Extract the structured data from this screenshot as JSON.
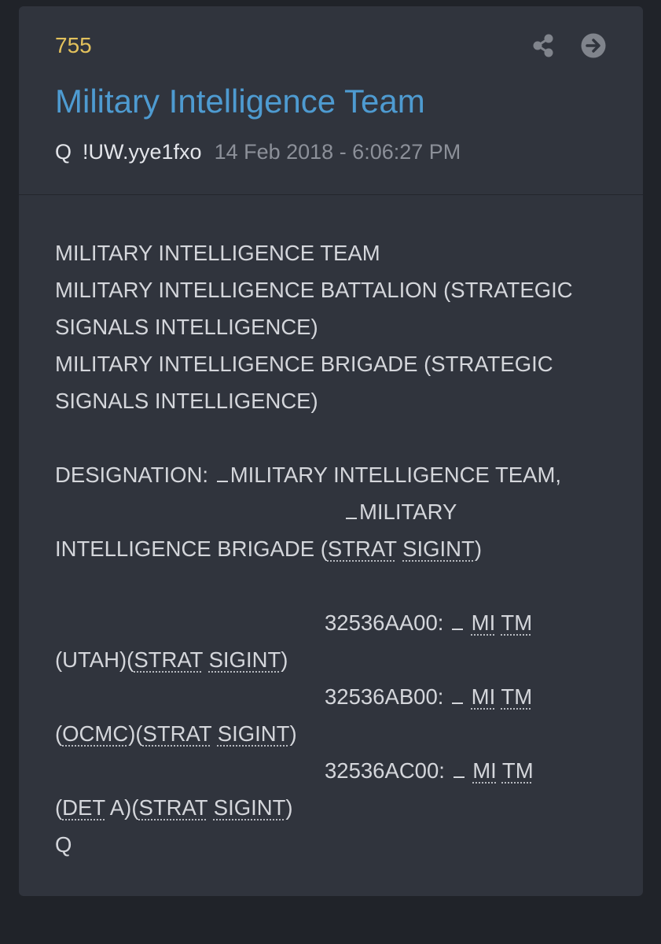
{
  "post": {
    "number": "755",
    "title": "Military Intelligence Team",
    "author": "Q",
    "tripcode": "!UW.yye1fxo",
    "timestamp": "14 Feb 2018 - 6:06:27 PM"
  },
  "icons": {
    "share": "share-icon",
    "go": "arrow-right-circle-icon",
    "color": "#80848c"
  },
  "colors": {
    "number": "#e2c15c",
    "title": "#4e9bd1",
    "text": "#d4d6db",
    "card": "#30343d",
    "background": "#202329"
  },
  "body": {
    "l1": "MILITARY INTELLIGENCE TEAM",
    "l2": "MILITARY INTELLIGENCE BATTALION (STRATEGIC",
    "l3": "SIGNALS INTELLIGENCE)",
    "l4": "MILITARY INTELLIGENCE BRIGADE (STRATEGIC",
    "l5": "SIGNALS INTELLIGENCE)",
    "designation_label": "DESIGNATION: ",
    "designation_rest": "MILITARY INTELLIGENCE TEAM,",
    "military": "MILITARY",
    "brigade_prefix": "INTELLIGENCE BRIGADE (",
    "strat": "STRAT",
    "sigint": "SIGINT",
    "mi": "MI",
    "tm": "TM",
    "code1": "32536AA00: ",
    "loc1": "UTAH",
    "code2": "32536AB00: ",
    "loc2": "OCMC",
    "code3": "32536AC00: ",
    "loc3_abbr": "DET",
    "loc3_rest": " A",
    "signature": "Q"
  }
}
